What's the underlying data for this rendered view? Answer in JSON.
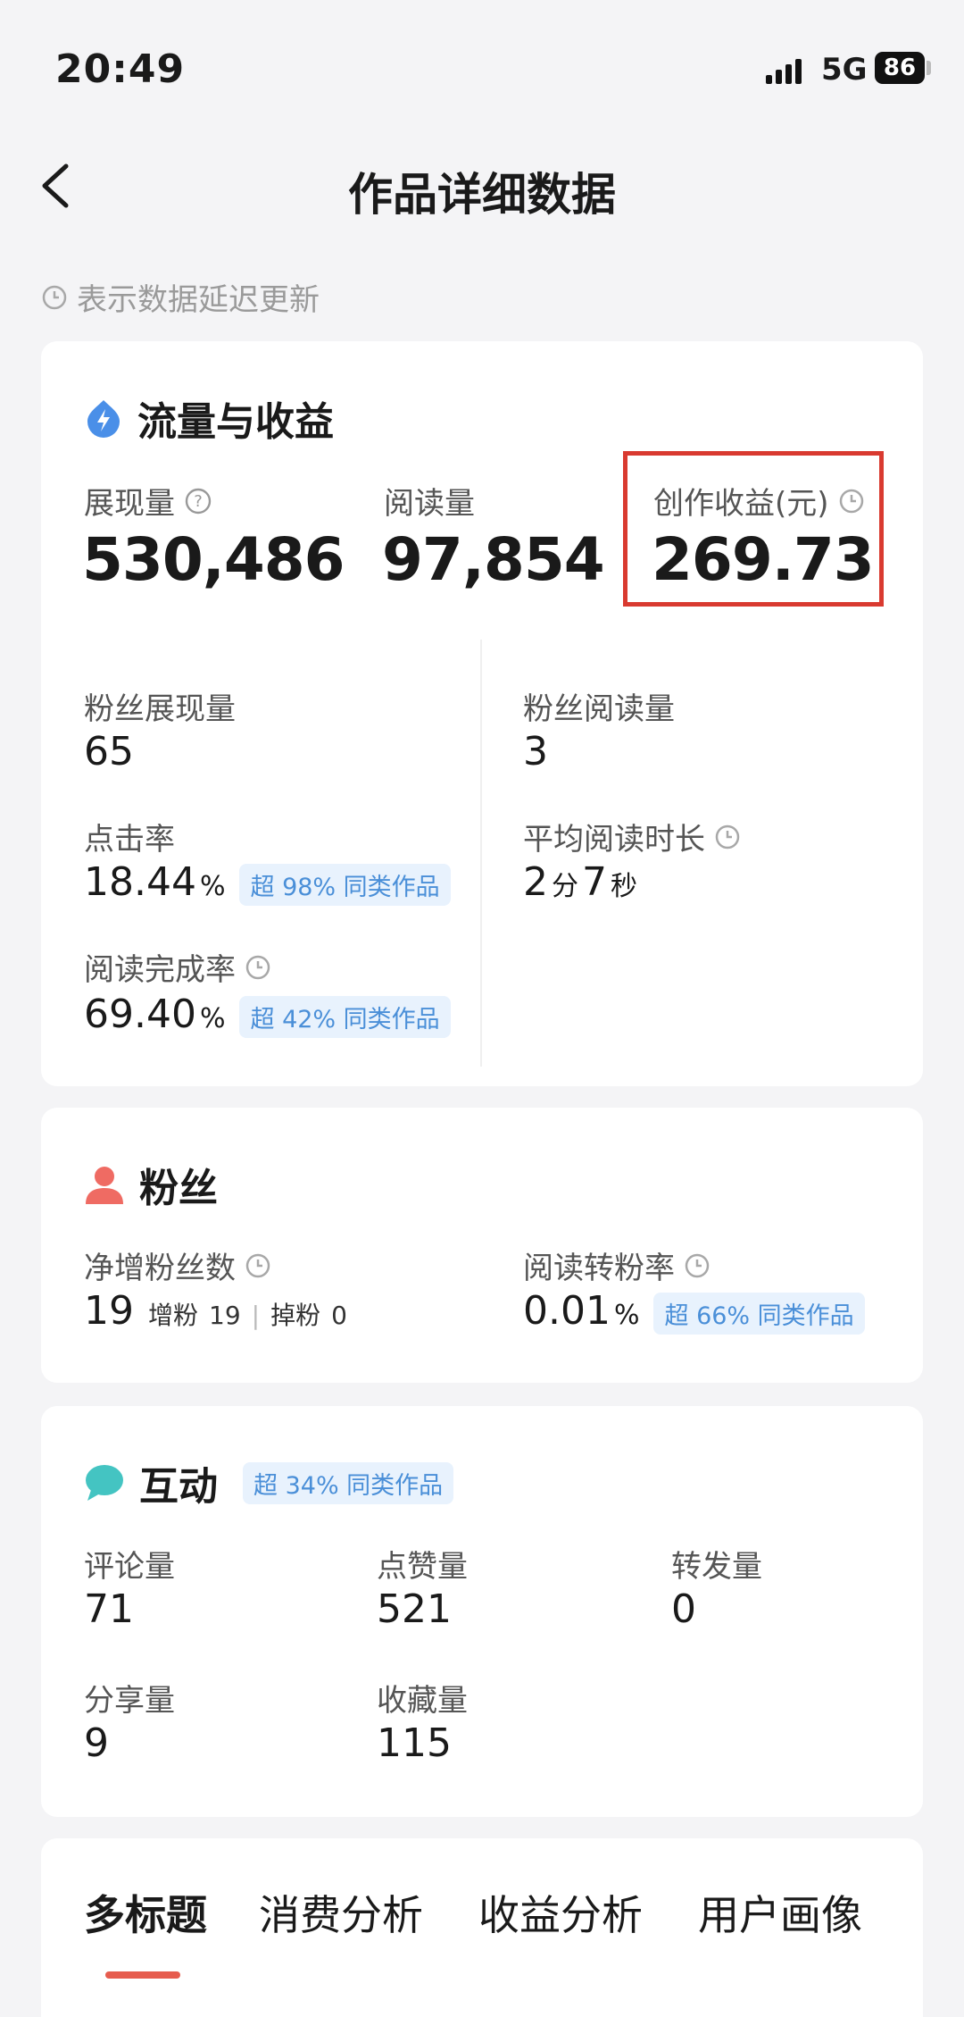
{
  "status_bar": {
    "time": "20:49",
    "network": "5G",
    "battery": "86"
  },
  "nav": {
    "title": "作品详细数据"
  },
  "delay_note": "表示数据延迟更新",
  "traffic": {
    "title": "流量与收益",
    "impressions_label": "展现量",
    "impressions_value": "530,486",
    "reads_label": "阅读量",
    "reads_value": "97,854",
    "earnings_label": "创作收益(元)",
    "earnings_value": "269.73",
    "fan_impressions_label": "粉丝展现量",
    "fan_impressions_value": "65",
    "fan_reads_label": "粉丝阅读量",
    "fan_reads_value": "3",
    "ctr_label": "点击率",
    "ctr_value": "18.44",
    "ctr_badge": "超 98% 同类作品",
    "avg_read_label": "平均阅读时长",
    "avg_read_min": "2",
    "avg_read_min_unit": "分",
    "avg_read_sec": "7",
    "avg_read_sec_unit": "秒",
    "completion_label": "阅读完成率",
    "completion_value": "69.40",
    "completion_badge": "超 42% 同类作品",
    "percent": "%"
  },
  "fans": {
    "title": "粉丝",
    "net_gain_label": "净增粉丝数",
    "net_gain_value": "19",
    "gain_label": "增粉",
    "gain_value": "19",
    "separator": "|",
    "loss_label": "掉粉",
    "loss_value": "0",
    "conversion_label": "阅读转粉率",
    "conversion_value": "0.01",
    "conversion_badge": "超 66% 同类作品"
  },
  "interaction": {
    "title": "互动",
    "badge": "超 34% 同类作品",
    "comments_label": "评论量",
    "comments_value": "71",
    "likes_label": "点赞量",
    "likes_value": "521",
    "reposts_label": "转发量",
    "reposts_value": "0",
    "shares_label": "分享量",
    "shares_value": "9",
    "favorites_label": "收藏量",
    "favorites_value": "115"
  },
  "tabs": [
    {
      "label": "多标题",
      "active": true
    },
    {
      "label": "消费分析"
    },
    {
      "label": "收益分析"
    },
    {
      "label": "用户画像"
    }
  ],
  "colors": {
    "accent_red": "#d93a30",
    "badge_blue": "#4a8fd8",
    "tab_underline": "#e65c4e"
  }
}
